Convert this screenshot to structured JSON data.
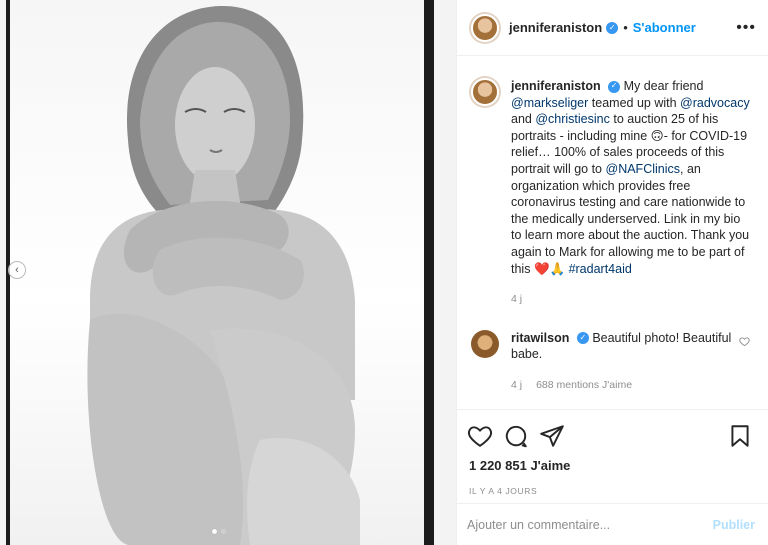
{
  "post": {
    "nav_prev_icon": "chevron-left-icon",
    "carousel": {
      "count": 2,
      "active": 0
    }
  },
  "header": {
    "username": "jenniferaniston",
    "separator": "•",
    "follow_label": "S'abonner",
    "more_label": "•••"
  },
  "caption": {
    "username": "jenniferaniston",
    "text_1": "My dear friend",
    "mention_1": "@markseliger",
    "text_2": "teamed up with",
    "mention_2": "@radvocacy",
    "text_3": "and",
    "mention_3": "@christiesinc",
    "text_4": "to auction 25 of his portraits - including mine",
    "emoji_1": "🙃",
    "text_5": "- for COVID-19 relief… 100% of sales proceeds of this portrait will go to",
    "mention_4": "@NAFClinics",
    "text_6": ", an organization which provides free coronavirus testing and care nationwide to the medically underserved. Link in my bio to learn more about the auction. Thank you again to Mark for allowing me to be part of this",
    "emoji_2": "❤️🙏",
    "hashtag": "#radart4aid",
    "time": "4 j"
  },
  "reply": {
    "username": "ritawilson",
    "text": "Beautiful photo! Beautiful babe.",
    "time": "4 j",
    "likes": "688 mentions J'aime",
    "heart_icon": "heart-outline-icon"
  },
  "actions": {
    "like_icon": "heart-outline-icon",
    "comment_icon": "comment-icon",
    "share_icon": "send-icon",
    "save_icon": "bookmark-icon",
    "likes_count": "1 220 851 J'aime",
    "date": "IL Y A 4 JOURS"
  },
  "add_comment": {
    "placeholder": "Ajouter un commentaire...",
    "publish_label": "Publier"
  },
  "colors": {
    "link": "#00376b",
    "follow": "#0095f6",
    "publish_disabled": "#b2dffc",
    "verified": "#3897f0",
    "muted": "#8e8e8e"
  }
}
